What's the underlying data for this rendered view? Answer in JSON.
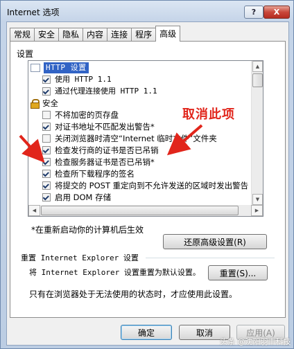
{
  "window": {
    "title": "Internet 选项",
    "help": "?",
    "close": "X"
  },
  "tabs": [
    "常规",
    "安全",
    "隐私",
    "内容",
    "连接",
    "程序",
    "高级"
  ],
  "settings": {
    "group_label": "设置",
    "items": [
      {
        "kind": "folder",
        "text": "HTTP 设置"
      },
      {
        "kind": "checkbox",
        "text": "使用 HTTP 1.1",
        "checked": true
      },
      {
        "kind": "checkbox",
        "text": "通过代理连接使用 HTTP 1.1",
        "checked": true
      },
      {
        "kind": "lock",
        "text": "安全"
      },
      {
        "kind": "checkbox",
        "text": "不将加密的页存盘",
        "checked": false
      },
      {
        "kind": "checkbox",
        "text": "对证书地址不匹配发出警告*",
        "checked": true
      },
      {
        "kind": "checkbox",
        "text": "关闭浏览器时清空“Internet 临时文件”文件夹",
        "checked": false
      },
      {
        "kind": "checkbox",
        "text": "检查发行商的证书是否已吊销",
        "checked": true
      },
      {
        "kind": "checkbox",
        "text": "检查服务器证书是否已吊销*",
        "checked": true
      },
      {
        "kind": "checkbox",
        "text": "检查所下载程序的签名",
        "checked": true
      },
      {
        "kind": "checkbox",
        "text": "将提交的 POST 重定向到不允许发送的区域时发出警告",
        "checked": true
      },
      {
        "kind": "checkbox",
        "text": "启用 DOM 存储",
        "checked": true
      }
    ],
    "restart_note": "*在重新启动你的计算机后生效",
    "restore_button": "还原高级设置(R)"
  },
  "reset": {
    "title": "重置 Internet Explorer 设置",
    "description": "将 Internet Explorer 设置重置为默认设置。",
    "button": "重置(S)...",
    "note": "只有在浏览器处于无法使用的状态时，才应使用此设置。"
  },
  "footer": {
    "ok": "确定",
    "cancel": "取消",
    "apply": "应用(A)"
  },
  "annotation": {
    "text": "取消此项",
    "color": "#e1251b"
  },
  "watermark": "头条 @沈阳羽丰科技"
}
